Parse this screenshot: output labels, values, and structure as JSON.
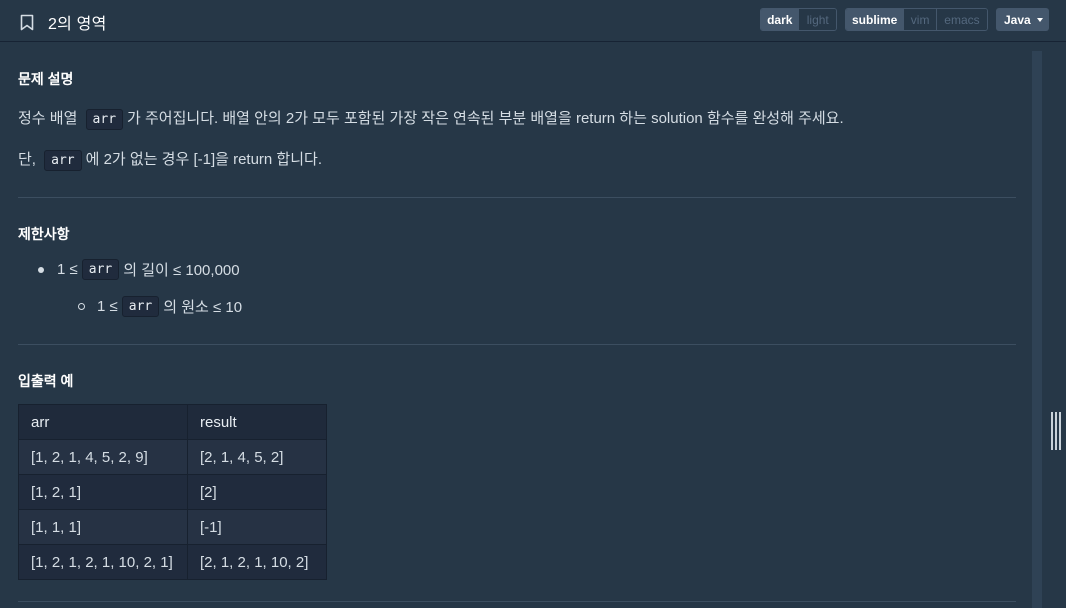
{
  "header": {
    "title": "2의 영역",
    "theme_options": [
      "dark",
      "light"
    ],
    "theme_selected": "dark",
    "editor_options": [
      "sublime",
      "vim",
      "emacs"
    ],
    "editor_selected": "sublime",
    "language": "Java"
  },
  "problem": {
    "section_description_title": "문제 설명",
    "desc_line1_pre": "정수 배열",
    "desc_line1_code": "arr",
    "desc_line1_post": "가 주어집니다. 배열 안의 2가 모두 포함된 가장 작은 연속된 부분 배열을 return 하는 solution 함수를 완성해 주세요.",
    "desc_line2_pre": "단,",
    "desc_line2_code": "arr",
    "desc_line2_post": "에 2가 없는 경우 [-1]을 return 합니다.",
    "section_constraints_title": "제한사항",
    "constraint1_pre": "1 ≤",
    "constraint1_code": "arr",
    "constraint1_post": "의 길이 ≤ 100,000",
    "constraint2_pre": "1 ≤",
    "constraint2_code": "arr",
    "constraint2_post": "의 원소 ≤ 10",
    "section_examples_title": "입출력 예"
  },
  "examples_table": {
    "headers": [
      "arr",
      "result"
    ],
    "rows": [
      [
        "[1, 2, 1, 4, 5, 2, 9]",
        "[2, 1, 4, 5, 2]"
      ],
      [
        "[1, 2, 1]",
        "[2]"
      ],
      [
        "[1, 1, 1]",
        "[-1]"
      ],
      [
        "[1, 2, 1, 2, 1, 10, 2, 1]",
        "[2, 1, 2, 1, 10, 2]"
      ]
    ]
  }
}
